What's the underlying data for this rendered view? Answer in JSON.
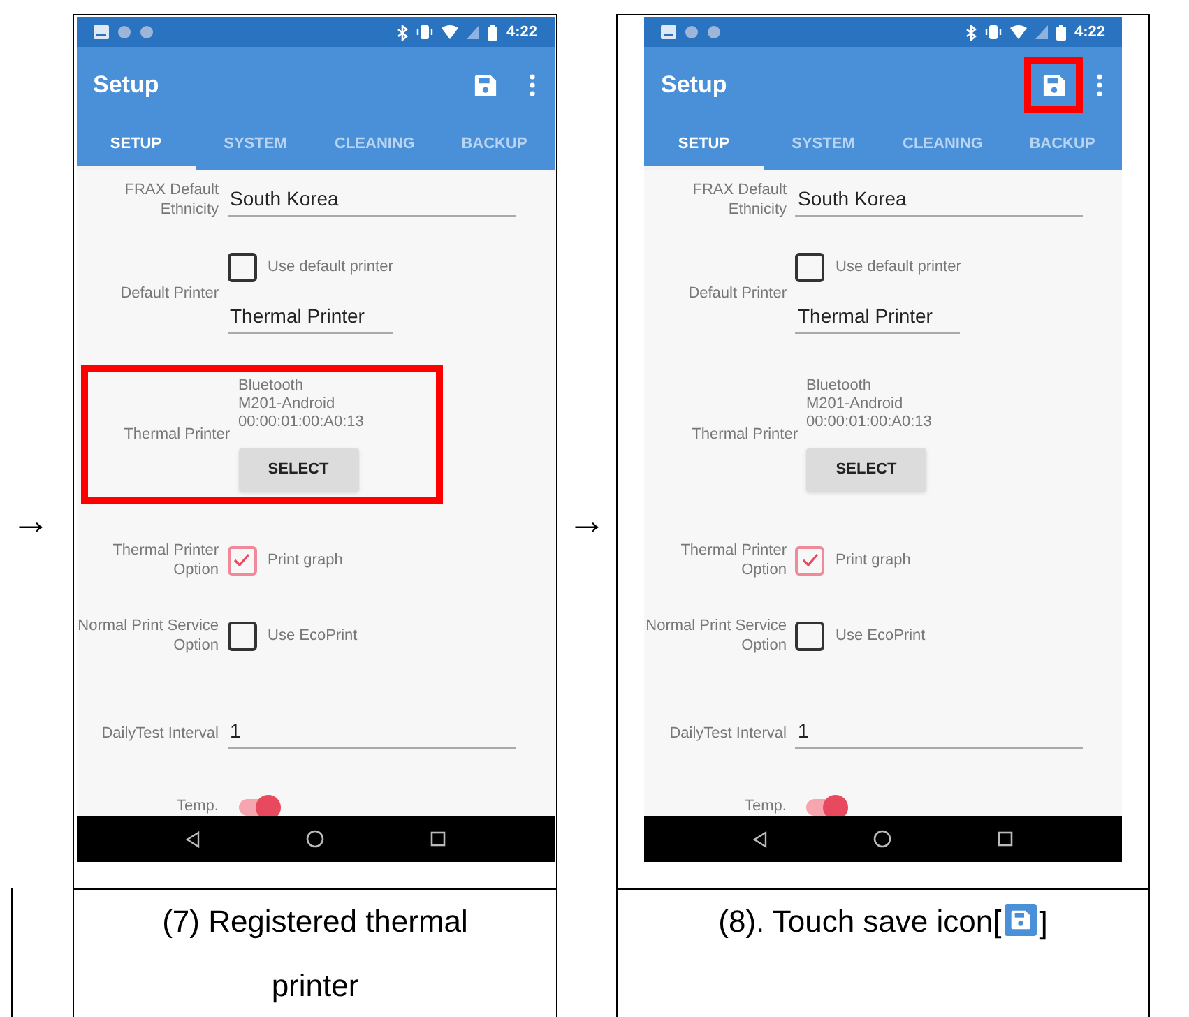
{
  "panels": [
    {
      "lead_arrow": "→",
      "screen": {
        "time": "4:22",
        "title": "Setup",
        "save_highlighted": false,
        "tabs": [
          {
            "label": "SETUP",
            "selected": true
          },
          {
            "label": "SYSTEM",
            "selected": false
          },
          {
            "label": "CLEANING",
            "selected": false
          },
          {
            "label": "BACKUP",
            "selected": false
          }
        ],
        "rows": [
          {
            "kind": "field",
            "label": "FRAX Default Ethnicity",
            "value": "South Korea"
          },
          {
            "kind": "printer_choice",
            "label": "Default Printer",
            "checkbox_label": "Use default printer",
            "checked": false,
            "value": "Thermal Printer"
          },
          {
            "kind": "device",
            "label": "Thermal Printer",
            "lines": [
              "Bluetooth",
              "M201-Android",
              "00:00:01:00:A0:13"
            ],
            "button": "SELECT",
            "highlighted": true
          },
          {
            "kind": "checkbox",
            "label": "Thermal Printer Option",
            "checkbox_label": "Print graph",
            "checked": true
          },
          {
            "kind": "checkbox",
            "label": "Normal Print Service Option",
            "checkbox_label": "Use EcoPrint",
            "checked": false
          },
          {
            "kind": "field",
            "label": "DailyTest Interval",
            "value": "1"
          },
          {
            "kind": "switch",
            "label": "Temp.",
            "on": true
          }
        ]
      },
      "caption": {
        "kind": "plain",
        "text": "(7) Registered thermal printer"
      }
    },
    {
      "lead_arrow": "→",
      "screen": {
        "time": "4:22",
        "title": "Setup",
        "save_highlighted": true,
        "tabs": [
          {
            "label": "SETUP",
            "selected": true
          },
          {
            "label": "SYSTEM",
            "selected": false
          },
          {
            "label": "CLEANING",
            "selected": false
          },
          {
            "label": "BACKUP",
            "selected": false
          }
        ],
        "rows": [
          {
            "kind": "field",
            "label": "FRAX Default Ethnicity",
            "value": "South Korea"
          },
          {
            "kind": "printer_choice",
            "label": "Default Printer",
            "checkbox_label": "Use default printer",
            "checked": false,
            "value": "Thermal Printer"
          },
          {
            "kind": "device",
            "label": "Thermal Printer",
            "lines": [
              "Bluetooth",
              "M201-Android",
              "00:00:01:00:A0:13"
            ],
            "button": "SELECT",
            "highlighted": false
          },
          {
            "kind": "checkbox",
            "label": "Thermal Printer Option",
            "checkbox_label": "Print graph",
            "checked": true
          },
          {
            "kind": "checkbox",
            "label": "Normal Print Service Option",
            "checkbox_label": "Use EcoPrint",
            "checked": false
          },
          {
            "kind": "field",
            "label": "DailyTest Interval",
            "value": "1"
          },
          {
            "kind": "switch",
            "label": "Temp.",
            "on": true
          }
        ]
      },
      "caption": {
        "kind": "with_icon",
        "text": "(8). Touch save icon[",
        "text_after": "]"
      }
    }
  ]
}
